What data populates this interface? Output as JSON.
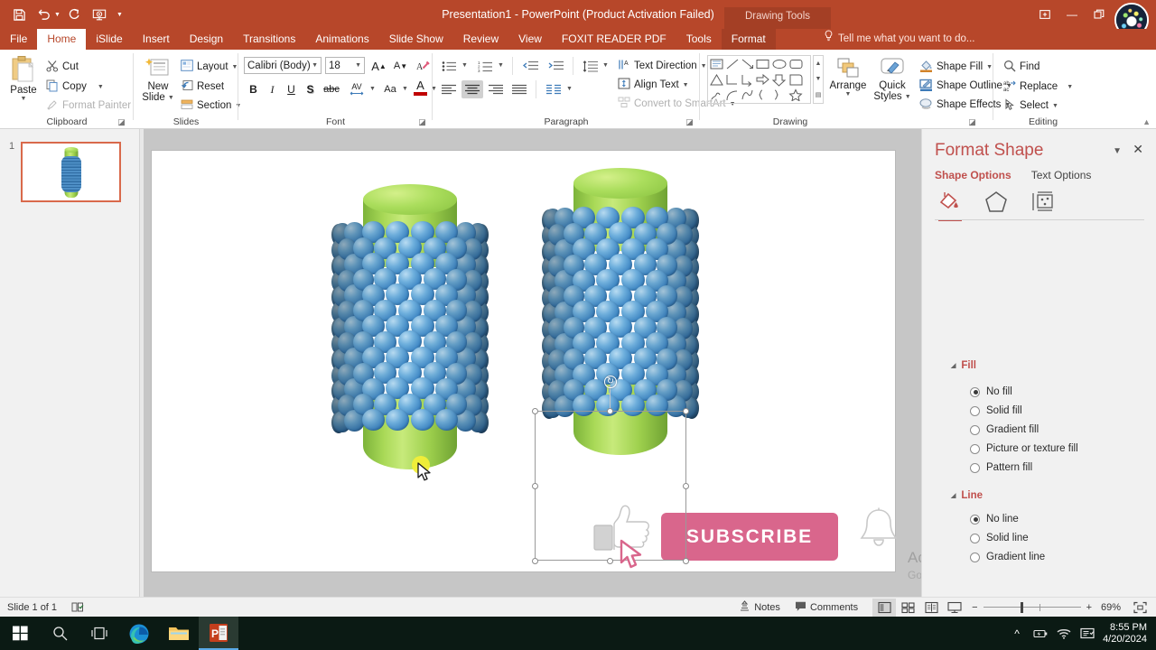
{
  "window": {
    "title": "Presentation1 - PowerPoint (Product Activation Failed)",
    "contextual_tab_group": "Drawing Tools",
    "accent_color": "#b7472a"
  },
  "quick_access": [
    {
      "name": "save",
      "glyph": "save-icon"
    },
    {
      "name": "undo",
      "glyph": "undo-icon"
    },
    {
      "name": "redo",
      "glyph": "redo-icon"
    },
    {
      "name": "start-slideshow",
      "glyph": "slideshow-icon"
    },
    {
      "name": "customize-qat",
      "glyph": "chevron-down-icon"
    }
  ],
  "window_controls": {
    "ribbon_display_options": "⊞",
    "minimize": "—",
    "restore": "❐",
    "signin": "person-icon"
  },
  "tabs": [
    {
      "label": "File",
      "active": false,
      "contextual": false
    },
    {
      "label": "Home",
      "active": true,
      "contextual": false
    },
    {
      "label": "iSlide",
      "active": false,
      "contextual": false
    },
    {
      "label": "Insert",
      "active": false,
      "contextual": false
    },
    {
      "label": "Design",
      "active": false,
      "contextual": false
    },
    {
      "label": "Transitions",
      "active": false,
      "contextual": false
    },
    {
      "label": "Animations",
      "active": false,
      "contextual": false
    },
    {
      "label": "Slide Show",
      "active": false,
      "contextual": false
    },
    {
      "label": "Review",
      "active": false,
      "contextual": false
    },
    {
      "label": "View",
      "active": false,
      "contextual": false
    },
    {
      "label": "FOXIT READER PDF",
      "active": false,
      "contextual": false
    },
    {
      "label": "Tools",
      "active": false,
      "contextual": false
    },
    {
      "label": "Format",
      "active": false,
      "contextual": true
    }
  ],
  "tell_me": {
    "placeholder": "Tell me what you want to do..."
  },
  "ribbon": {
    "clipboard": {
      "label": "Clipboard",
      "paste": "Paste",
      "cut": "Cut",
      "copy": "Copy",
      "format_painter": "Format Painter"
    },
    "slides": {
      "label": "Slides",
      "new_slide_line1": "New",
      "new_slide_line2": "Slide",
      "layout": "Layout",
      "reset": "Reset",
      "section": "Section"
    },
    "font": {
      "label": "Font",
      "font_name": "Calibri (Body)",
      "font_size": "18",
      "grow": "A",
      "shrink": "A",
      "clear_formatting": "clear-formatting-icon",
      "bold": "B",
      "italic": "I",
      "underline": "U",
      "shadow": "S",
      "strikethrough": "abc",
      "character_spacing": "AV",
      "change_case": "Aa",
      "font_color": "A"
    },
    "paragraph": {
      "label": "Paragraph",
      "bullets": "bullets-icon",
      "numbering": "numbering-icon",
      "decrease_indent": "decrease-indent-icon",
      "increase_indent": "increase-indent-icon",
      "line_spacing": "line-spacing-icon",
      "text_direction": "Text Direction",
      "align_text": "Align Text",
      "convert_to_smartart": "Convert to SmartArt",
      "align_left": "align-left-icon",
      "align_center": "align-center-icon",
      "align_right": "align-right-icon",
      "justify": "justify-icon",
      "columns": "columns-icon"
    },
    "drawing": {
      "label": "Drawing",
      "arrange": "Arrange",
      "quick_styles_line1": "Quick",
      "quick_styles_line2": "Styles",
      "shape_fill": "Shape Fill",
      "shape_outline": "Shape Outline",
      "shape_effects": "Shape Effects"
    },
    "editing": {
      "label": "Editing",
      "find": "Find",
      "replace": "Replace",
      "select": "Select"
    }
  },
  "thumbnails": {
    "items": [
      {
        "number": "1",
        "selected": true
      }
    ]
  },
  "slide": {
    "shapes": [
      {
        "name": "corn-shape-left",
        "selected": false,
        "cylinder_color": "#9ed04d",
        "kernel_color": "#3e86c4",
        "rows": 13,
        "cols": 9
      },
      {
        "name": "corn-shape-right",
        "selected": true,
        "cylinder_color": "#9ed04d",
        "kernel_color": "#3e86c4",
        "rows": 13,
        "cols": 9
      }
    ],
    "subscribe_button": {
      "label": "SUBSCRIBE",
      "color": "#d9668c"
    },
    "thumbs_up_icon": "thumbs-up-icon",
    "bell_icon": "bell-icon"
  },
  "format_shape": {
    "title": "Format Shape",
    "tabs": [
      {
        "label": "Shape Options",
        "active": true
      },
      {
        "label": "Text Options",
        "active": false
      }
    ],
    "icon_tabs": [
      {
        "name": "fill-and-line-icon",
        "active": true
      },
      {
        "name": "effects-pentagon-icon",
        "active": false
      },
      {
        "name": "size-and-properties-icon",
        "active": false
      }
    ],
    "sections": [
      {
        "name": "Fill",
        "expanded": true,
        "options": [
          {
            "label": "No fill",
            "selected": true
          },
          {
            "label": "Solid fill",
            "selected": false
          },
          {
            "label": "Gradient fill",
            "selected": false
          },
          {
            "label": "Picture or texture fill",
            "selected": false
          },
          {
            "label": "Pattern fill",
            "selected": false
          }
        ]
      },
      {
        "name": "Line",
        "expanded": true,
        "options": [
          {
            "label": "No line",
            "selected": true
          },
          {
            "label": "Solid line",
            "selected": false
          },
          {
            "label": "Gradient line",
            "selected": false
          }
        ]
      }
    ]
  },
  "status_bar": {
    "slide_indicator": "Slide 1 of 1",
    "accessibility_icon": "accessibility-check-icon",
    "notes": "Notes",
    "comments": "Comments",
    "views": [
      {
        "name": "normal-view",
        "active": true
      },
      {
        "name": "slide-sorter-view",
        "active": false
      },
      {
        "name": "reading-view",
        "active": false
      },
      {
        "name": "slide-show-view",
        "active": false
      }
    ],
    "zoom_out": "−",
    "zoom_in": "+",
    "zoom_level": "69%",
    "fit_to_window": "fit-slide-icon"
  },
  "watermark": {
    "title": "Activate Windows",
    "subtitle": "Go to Settings to activate Windows."
  },
  "taskbar": {
    "buttons": [
      {
        "name": "start-button",
        "glyph": "windows-icon"
      },
      {
        "name": "search-button",
        "glyph": "search-icon"
      },
      {
        "name": "task-view-button",
        "glyph": "task-view-icon"
      },
      {
        "name": "edge-button",
        "glyph": "edge-icon"
      },
      {
        "name": "file-explorer-button",
        "glyph": "folder-icon"
      },
      {
        "name": "powerpoint-button",
        "glyph": "powerpoint-icon"
      }
    ],
    "tray": {
      "show_hidden": "^",
      "icons": [
        "battery-icon",
        "wifi-icon",
        "action-center-icon"
      ],
      "time": "8:55 PM",
      "date": "4/20/2024"
    }
  }
}
